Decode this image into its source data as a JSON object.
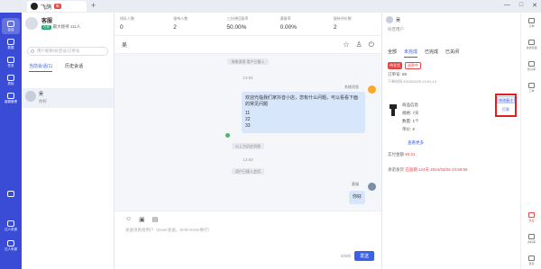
{
  "window": {
    "tab_title": "飞鸽",
    "tab_badge": "新",
    "new_tab": "+",
    "controls": [
      "—",
      "□",
      "✕"
    ]
  },
  "nav": [
    "会话",
    "数据",
    "任务",
    "质检",
    "客服管理",
    "设置",
    "达人来源",
    "达人来源"
  ],
  "agent": {
    "name": "客服",
    "badge": "在线",
    "queue": "最大接待 111人"
  },
  "search": {
    "placeholder": "用户昵称/抖音号/订单号"
  },
  "conv_tabs": [
    "当前会话(1)",
    "历史会话"
  ],
  "conversation": {
    "name": "吴",
    "preview": "你好",
    "time": "14:53"
  },
  "stats": [
    {
      "label": "排队人数",
      "value": "0"
    },
    {
      "label": "接待人数",
      "value": "2"
    },
    {
      "label": "三分钟回复率",
      "value": "50.00%"
    },
    {
      "label": "满意率",
      "value": "0.00%"
    },
    {
      "label": "接待评价数",
      "value": "2"
    }
  ],
  "chat": {
    "title": "吴",
    "system1": "系统消息 用户已接入",
    "time1": "14:52",
    "sender1": "系统消息",
    "bubble_line1": "欢迎光临我们家抖音小店，您有什么问题，可以看看下面的常见问题",
    "bubble_items": [
      "11",
      "22",
      "33"
    ],
    "divider": "以上为历史消息",
    "time2": "14:53",
    "system2": "用户已接入会话",
    "sender2": "客服",
    "reply": "你好"
  },
  "input": {
    "placeholder": "发送消息给用户（Enter发送，Shift+Enter换行）",
    "counter": "0/500",
    "send": "发送"
  },
  "right": {
    "name": "吴",
    "subtitle": "抖音用户",
    "order_tabs": [
      "全部",
      "未完成",
      "已完成",
      "已关闭"
    ],
    "tags": [
      "待发货",
      "退款中"
    ],
    "order_id": "订单号: 69",
    "order_time": "下单时间 2024/03/25 20:51:13",
    "product_lines": [
      "商品信息",
      "规格: 7天",
      "数量: 1个",
      "单价: ¥"
    ],
    "more": "查看更多",
    "actual_label": "实付金额",
    "actual_value": "¥0.01",
    "deadline_label": "承诺发货",
    "deadline_value": "已逾期 124天 2024/03/26 23:59:59",
    "modify_btn": "修改备注",
    "print_btn": "打款"
  },
  "side": [
    "订单",
    "快捷短语",
    "知识库",
    "工单",
    "售后",
    "资料库",
    "更多"
  ]
}
